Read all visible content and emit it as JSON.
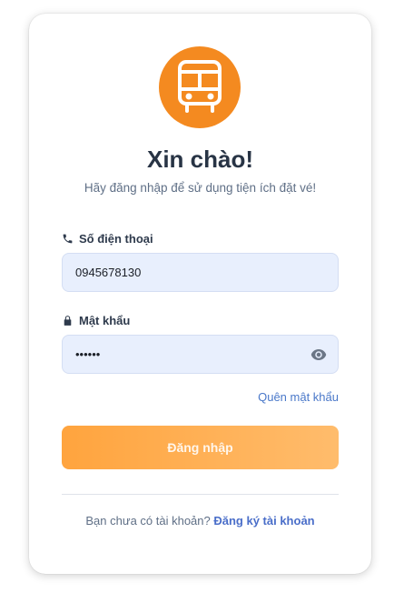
{
  "header": {
    "logo_icon": "bus-icon",
    "title": "Xin chào!",
    "subtitle": "Hãy đăng nhập để sử dụng tiện ích đặt vé!"
  },
  "form": {
    "phone": {
      "icon": "phone-icon",
      "label": "Số điện thoại",
      "value": "0945678130"
    },
    "password": {
      "icon": "lock-icon",
      "label": "Mật khẩu",
      "value": "123456",
      "toggle_icon": "eye-icon"
    },
    "forgot_label": "Quên mật khẩu",
    "submit_label": "Đăng nhập"
  },
  "footer": {
    "prompt": "Bạn chưa có tài khoản? ",
    "signup_label": "Đăng ký tài khoản"
  },
  "colors": {
    "brand_orange": "#f48a20",
    "button_gradient_start": "#ffa43e",
    "button_gradient_end": "#ffbc6c",
    "input_bg": "#e8effd",
    "link": "#4a6ec9"
  }
}
